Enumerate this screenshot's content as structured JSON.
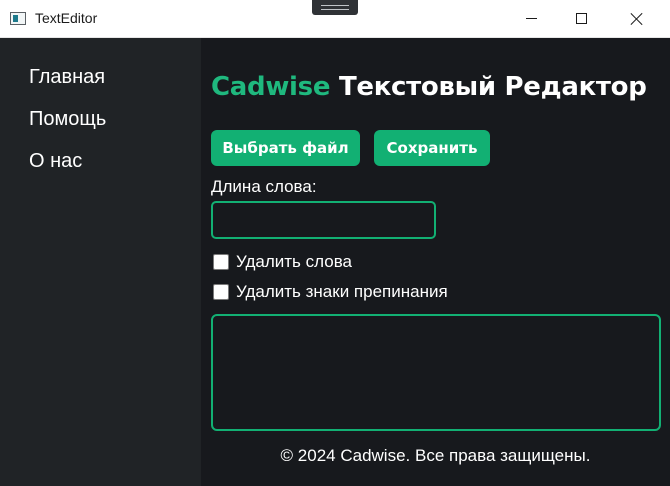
{
  "window": {
    "title": "TextEditor",
    "icon": "app-window-icon",
    "controls": [
      "minimize-icon",
      "maximize-icon",
      "close-icon"
    ]
  },
  "sidebar": {
    "items": [
      {
        "label": "Главная"
      },
      {
        "label": "Помощь"
      },
      {
        "label": "О нас"
      }
    ]
  },
  "main": {
    "heading_brand": "Cadwise",
    "heading_rest": " Текстовый Редактор",
    "choose_file_label": "Выбрать файл",
    "save_label": "Сохранить",
    "word_length_label": "Длина слова:",
    "word_length_value": "",
    "remove_words_label": "Удалить слова",
    "remove_words_checked": false,
    "remove_punctuation_label": "Удалить знаки препинания",
    "remove_punctuation_checked": false,
    "text_content": "",
    "footer": "© 2024 Cadwise. Все права защищены."
  },
  "colors": {
    "accent": "#12b073",
    "sidebar_bg": "#202326",
    "main_bg": "#17191d",
    "text": "#ffffff"
  }
}
